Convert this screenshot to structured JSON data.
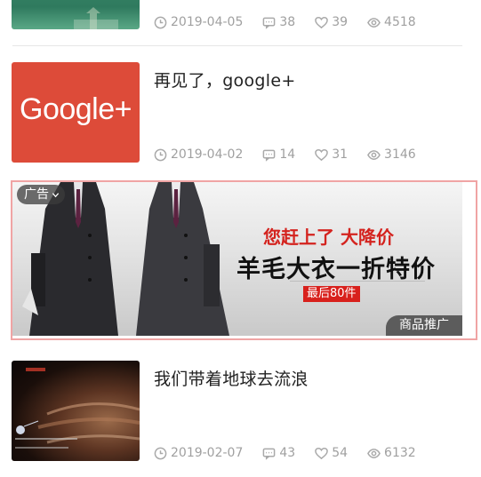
{
  "articles": [
    {
      "title": "",
      "date": "2019-04-05",
      "comments": "38",
      "likes": "39",
      "views": "4518"
    },
    {
      "title": "再见了，google+",
      "date": "2019-04-02",
      "comments": "14",
      "likes": "31",
      "views": "3146",
      "thumb_text": "Google+"
    },
    {
      "title": "我们带着地球去流浪",
      "date": "2019-02-07",
      "comments": "43",
      "likes": "54",
      "views": "6132"
    }
  ],
  "ad": {
    "label": "广告",
    "headline": "您赶上了  大降价",
    "big": "羊毛大衣一折特价",
    "tag": "最后80件",
    "promo": "商品推广"
  },
  "colors": {
    "google_red": "#dd4b39",
    "ad_red": "#d4231e",
    "meta_gray": "#a0a0a0"
  },
  "icons": [
    "clock-icon",
    "comment-icon",
    "heart-icon",
    "eye-icon",
    "chevron-down-icon"
  ]
}
